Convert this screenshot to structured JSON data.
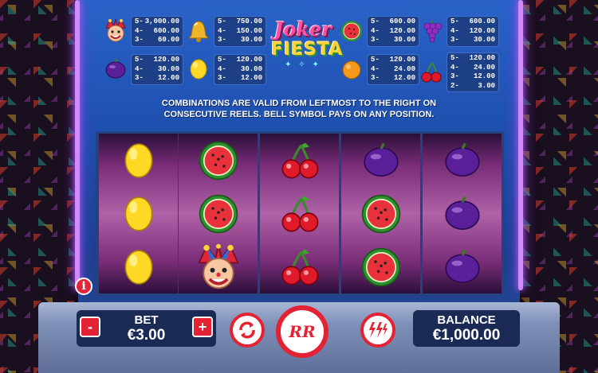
{
  "game": {
    "logo_line1": "Joker",
    "logo_line2": "FIESTA",
    "rules_line1": "COMBINATIONS ARE VALID FROM LEFTMOST TO THE RIGHT ON",
    "rules_line2": "CONSECUTIVE REELS. BELL SYMBOL PAYS ON ANY POSITION."
  },
  "paytable": [
    {
      "symbol": "joker-icon",
      "rows": [
        {
          "n": "5-",
          "v": "3,000.00"
        },
        {
          "n": "4-",
          "v": "600.00"
        },
        {
          "n": "3-",
          "v": "60.00"
        }
      ]
    },
    {
      "symbol": "bell-icon",
      "rows": [
        {
          "n": "5-",
          "v": "750.00"
        },
        {
          "n": "4-",
          "v": "150.00"
        },
        {
          "n": "3-",
          "v": "30.00"
        }
      ]
    },
    {
      "symbol": "watermelon-icon",
      "rows": [
        {
          "n": "5-",
          "v": "600.00"
        },
        {
          "n": "4-",
          "v": "120.00"
        },
        {
          "n": "3-",
          "v": "30.00"
        }
      ]
    },
    {
      "symbol": "grapes-icon",
      "rows": [
        {
          "n": "5-",
          "v": "600.00"
        },
        {
          "n": "4-",
          "v": "120.00"
        },
        {
          "n": "3-",
          "v": "30.00"
        }
      ]
    },
    {
      "symbol": "plum-icon",
      "rows": [
        {
          "n": "5-",
          "v": "120.00"
        },
        {
          "n": "4-",
          "v": "30.00"
        },
        {
          "n": "3-",
          "v": "12.00"
        }
      ]
    },
    {
      "symbol": "lemon-icon",
      "rows": [
        {
          "n": "5-",
          "v": "120.00"
        },
        {
          "n": "4-",
          "v": "30.00"
        },
        {
          "n": "3-",
          "v": "12.00"
        }
      ]
    },
    {
      "symbol": "orange-icon",
      "rows": [
        {
          "n": "5-",
          "v": "120.00"
        },
        {
          "n": "4-",
          "v": "24.00"
        },
        {
          "n": "3-",
          "v": "12.00"
        }
      ]
    },
    {
      "symbol": "cherry-icon",
      "rows": [
        {
          "n": "5-",
          "v": "120.00"
        },
        {
          "n": "4-",
          "v": "24.00"
        },
        {
          "n": "3-",
          "v": "12.00"
        },
        {
          "n": "2-",
          "v": "3.00"
        }
      ]
    }
  ],
  "reels": [
    [
      "lemon",
      "lemon",
      "lemon"
    ],
    [
      "watermelon",
      "watermelon",
      "joker"
    ],
    [
      "cherry",
      "cherry",
      "cherry"
    ],
    [
      "plum",
      "watermelon",
      "watermelon"
    ],
    [
      "plum",
      "plum",
      "plum"
    ]
  ],
  "controls": {
    "info_label": "i",
    "bet_label": "BET",
    "bet_value": "€3.00",
    "minus_label": "-",
    "plus_label": "+",
    "spin_label": "RR",
    "balance_label": "BALANCE",
    "balance_value": "€1,000.00"
  },
  "colors": {
    "accent_red": "#e32233",
    "cabinet_blue": "#2a63c9",
    "neon": "#d08cff"
  }
}
